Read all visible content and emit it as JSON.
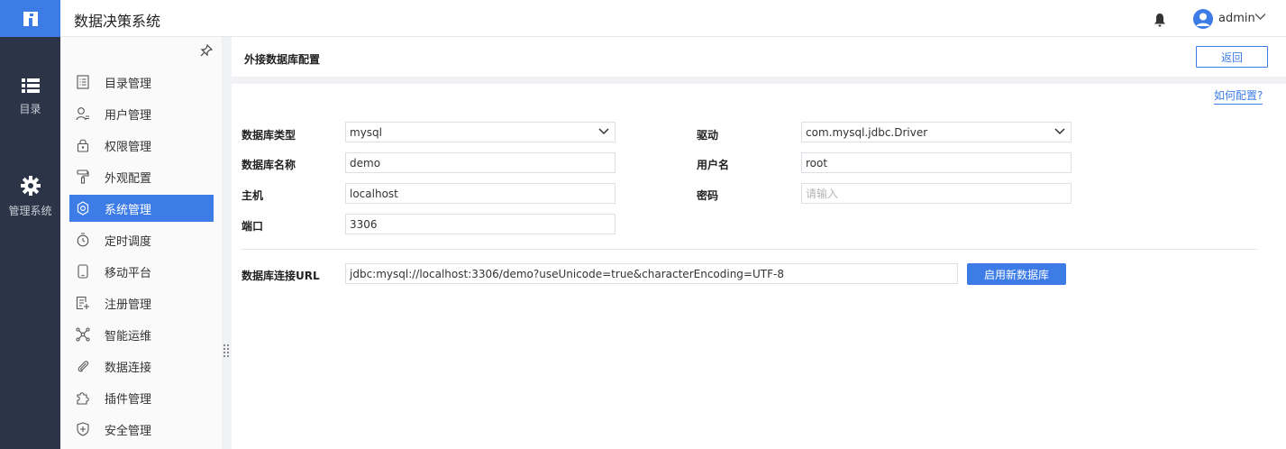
{
  "app": {
    "title": "数据决策系统"
  },
  "rail": {
    "items": [
      {
        "label": "目录",
        "icon": "list-icon"
      },
      {
        "label": "管理系统",
        "icon": "gear-icon"
      }
    ]
  },
  "header": {
    "user": "admin",
    "icons": [
      "bell-icon",
      "user-avatar-icon",
      "chevron-down-icon"
    ]
  },
  "submenu": {
    "items": [
      {
        "label": "目录管理",
        "icon": "catalog-icon"
      },
      {
        "label": "用户管理",
        "icon": "user-icon"
      },
      {
        "label": "权限管理",
        "icon": "lock-icon"
      },
      {
        "label": "外观配置",
        "icon": "paint-roller-icon"
      },
      {
        "label": "系统管理",
        "icon": "settings-icon",
        "active": true
      },
      {
        "label": "定时调度",
        "icon": "timer-icon"
      },
      {
        "label": "移动平台",
        "icon": "mobile-icon"
      },
      {
        "label": "注册管理",
        "icon": "register-icon"
      },
      {
        "label": "智能运维",
        "icon": "network-icon"
      },
      {
        "label": "数据连接",
        "icon": "paperclip-icon"
      },
      {
        "label": "插件管理",
        "icon": "puzzle-icon"
      },
      {
        "label": "安全管理",
        "icon": "shield-icon"
      }
    ]
  },
  "page": {
    "title": "外接数据库配置",
    "back_label": "返回",
    "help_label": "如何配置?"
  },
  "form": {
    "db_type": {
      "label": "数据库类型",
      "value": "mysql"
    },
    "driver": {
      "label": "驱动",
      "value": "com.mysql.jdbc.Driver"
    },
    "db_name": {
      "label": "数据库名称",
      "value": "demo"
    },
    "username": {
      "label": "用户名",
      "value": "root"
    },
    "host": {
      "label": "主机",
      "value": "localhost"
    },
    "password": {
      "label": "密码",
      "placeholder": "请输入"
    },
    "port": {
      "label": "端口",
      "value": "3306"
    },
    "url": {
      "label": "数据库连接URL",
      "value": "jdbc:mysql://localhost:3306/demo?useUnicode=true&characterEncoding=UTF-8"
    },
    "enable_label": "启用新数据库"
  },
  "colors": {
    "accent": "#3d7ce6",
    "rail": "#2c3547"
  }
}
